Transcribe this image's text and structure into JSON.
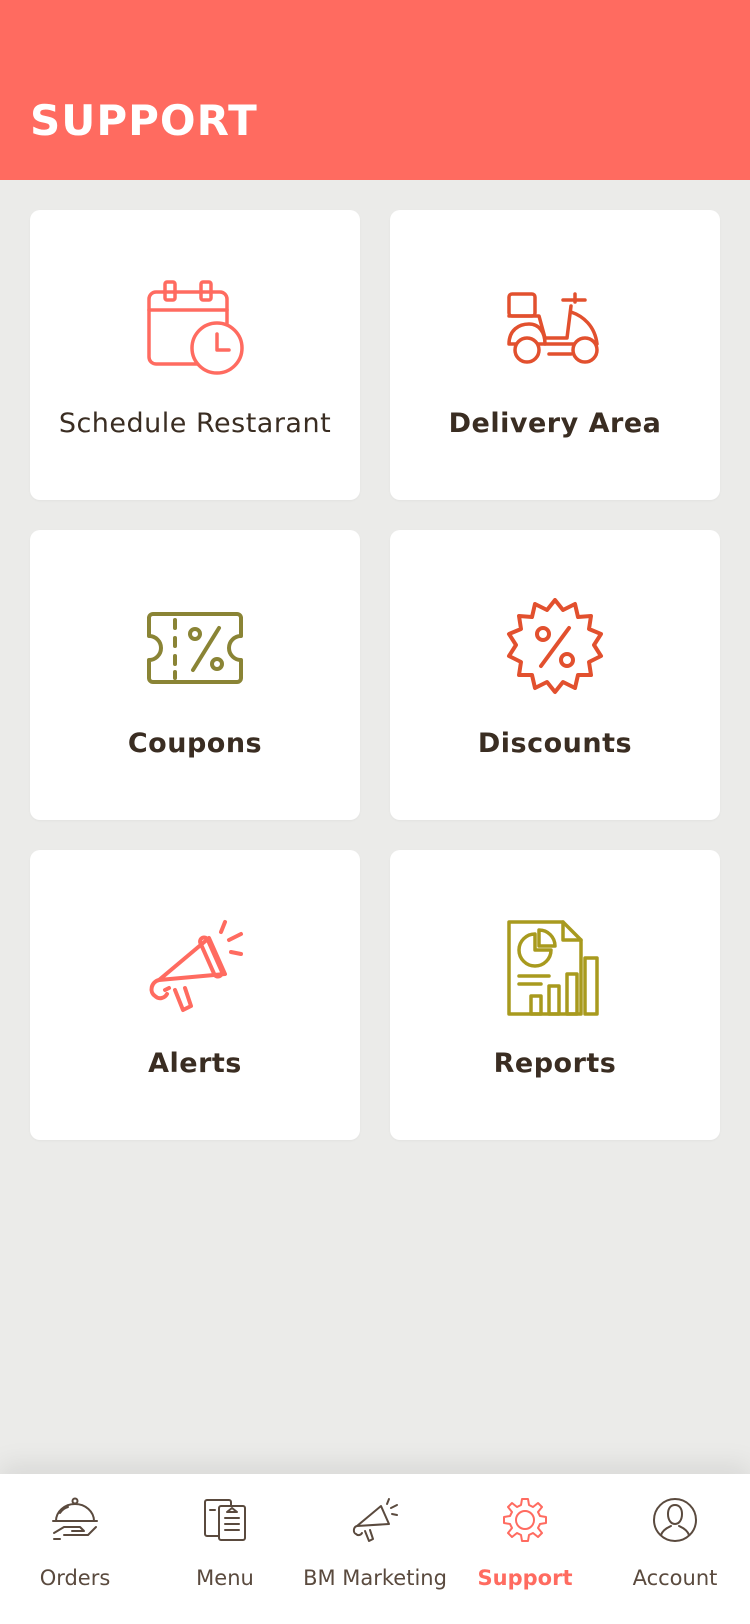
{
  "header": {
    "title": "SUPPORT"
  },
  "cards": [
    {
      "label": "Schedule Restarant",
      "icon": "calendar-clock-icon"
    },
    {
      "label": "Delivery Area",
      "icon": "scooter-icon"
    },
    {
      "label": "Coupons",
      "icon": "coupon-icon"
    },
    {
      "label": "Discounts",
      "icon": "discount-badge-icon"
    },
    {
      "label": "Alerts",
      "icon": "megaphone-icon"
    },
    {
      "label": "Reports",
      "icon": "report-chart-icon"
    }
  ],
  "nav": {
    "items": [
      {
        "label": "Orders",
        "icon": "cloche-icon"
      },
      {
        "label": "Menu",
        "icon": "menu-document-icon"
      },
      {
        "label": "BM Marketing",
        "icon": "megaphone-icon"
      },
      {
        "label": "Support",
        "icon": "gear-icon",
        "active": true
      },
      {
        "label": "Account",
        "icon": "user-icon"
      }
    ]
  },
  "colors": {
    "accent": "#ff6b60",
    "text_dark": "#3a2d22",
    "olive": "#8a8435",
    "orange": "#e2502e",
    "mustard": "#a89a1e",
    "background": "#ebebe9"
  }
}
